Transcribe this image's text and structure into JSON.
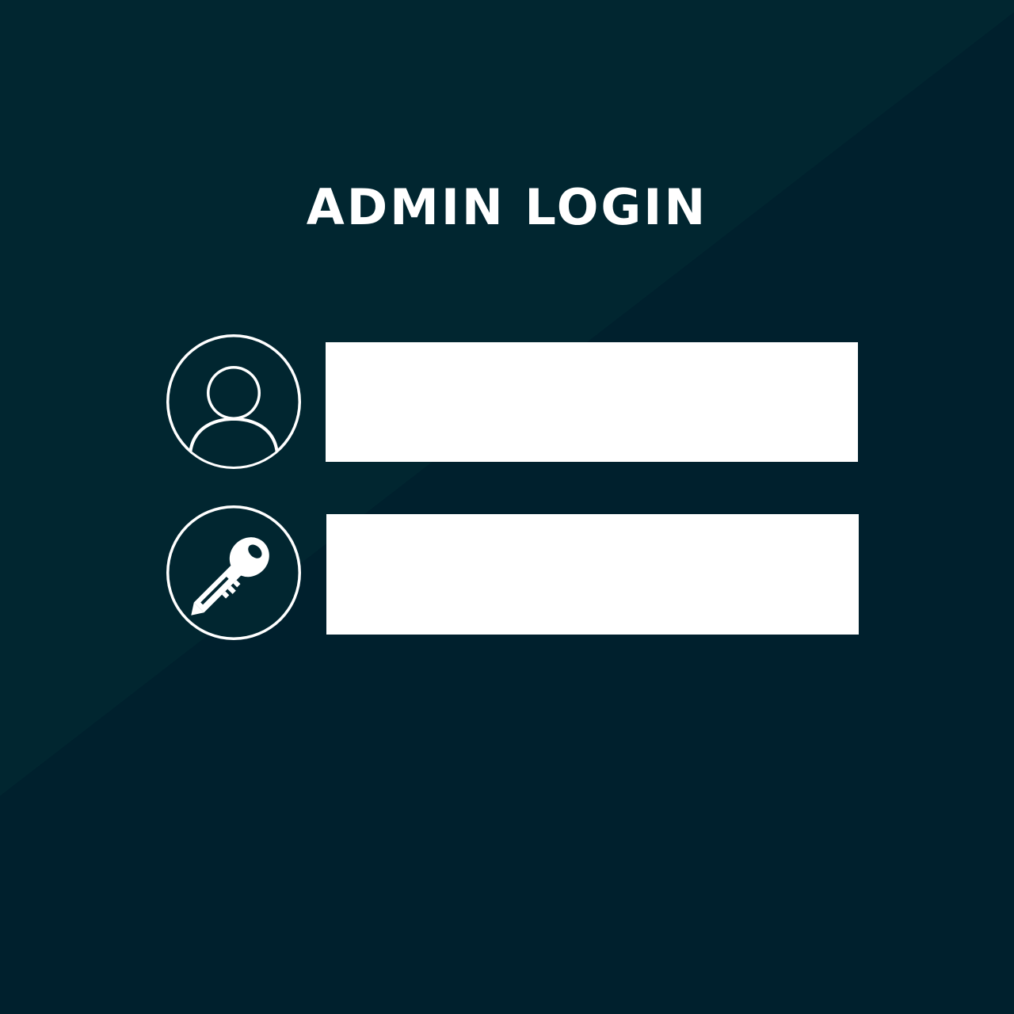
{
  "login": {
    "title": "ADMIN LOGIN",
    "username": {
      "icon": "user-icon",
      "value": "",
      "placeholder": ""
    },
    "password": {
      "icon": "key-icon",
      "value": "",
      "placeholder": ""
    }
  },
  "colors": {
    "background": "#00202d",
    "background_band": "#012630",
    "foreground": "#ffffff"
  }
}
